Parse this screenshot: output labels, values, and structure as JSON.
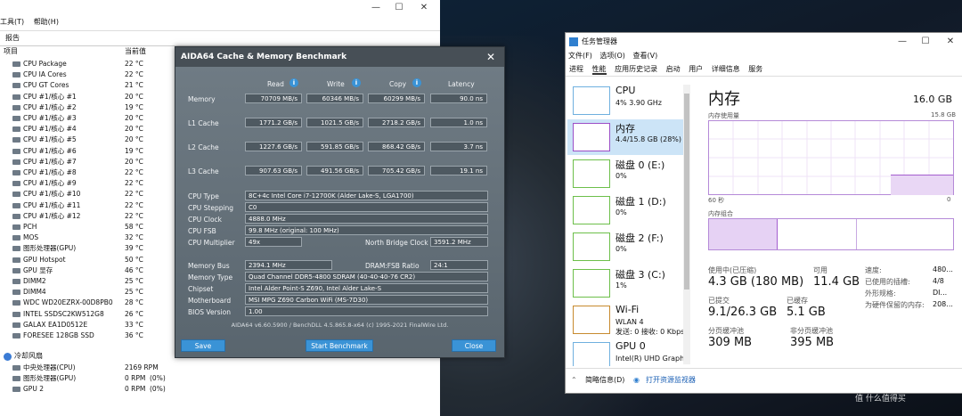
{
  "sensor_window": {
    "menu": [
      "工具(T)",
      "帮助(H)"
    ],
    "report_label": "报告",
    "col_item": "项目",
    "col_value": "当前值",
    "rows": [
      {
        "name": "CPU Package",
        "value": "22 °C"
      },
      {
        "name": "CPU IA Cores",
        "value": "22 °C"
      },
      {
        "name": "CPU GT Cores",
        "value": "21 °C"
      },
      {
        "name": "CPU #1/核心 #1",
        "value": "20 °C"
      },
      {
        "name": "CPU #1/核心 #2",
        "value": "19 °C"
      },
      {
        "name": "CPU #1/核心 #3",
        "value": "20 °C"
      },
      {
        "name": "CPU #1/核心 #4",
        "value": "20 °C"
      },
      {
        "name": "CPU #1/核心 #5",
        "value": "20 °C"
      },
      {
        "name": "CPU #1/核心 #6",
        "value": "19 °C"
      },
      {
        "name": "CPU #1/核心 #7",
        "value": "20 °C"
      },
      {
        "name": "CPU #1/核心 #8",
        "value": "22 °C"
      },
      {
        "name": "CPU #1/核心 #9",
        "value": "22 °C"
      },
      {
        "name": "CPU #1/核心 #10",
        "value": "22 °C"
      },
      {
        "name": "CPU #1/核心 #11",
        "value": "22 °C"
      },
      {
        "name": "CPU #1/核心 #12",
        "value": "22 °C"
      },
      {
        "name": "PCH",
        "value": "58 °C"
      },
      {
        "name": "MOS",
        "value": "32 °C"
      },
      {
        "name": "图形处理器(GPU)",
        "value": "39 °C"
      },
      {
        "name": "GPU Hotspot",
        "value": "50 °C"
      },
      {
        "name": "GPU 显存",
        "value": "46 °C"
      },
      {
        "name": "DIMM2",
        "value": "25 °C"
      },
      {
        "name": "DIMM4",
        "value": "25 °C"
      },
      {
        "name": "WDC WD20EZRX-00D8PB0",
        "value": "28 °C"
      },
      {
        "name": "INTEL SSDSC2KW512G8",
        "value": "26 °C"
      },
      {
        "name": "GALAX EA1D0512E",
        "value": "33 °C"
      },
      {
        "name": "FORESEE 128GB SSD",
        "value": "36 °C"
      }
    ],
    "fan_header": "冷却风扇",
    "fans": [
      {
        "name": "中央处理器(CPU)",
        "value": "2169 RPM",
        "pct": ""
      },
      {
        "name": "图形处理器(GPU)",
        "value": "0 RPM",
        "pct": "(0%)"
      },
      {
        "name": "GPU 2",
        "value": "0 RPM",
        "pct": "(0%)"
      }
    ]
  },
  "aida": {
    "title": "AIDA64 Cache & Memory Benchmark",
    "cols": [
      "Read",
      "Write",
      "Copy",
      "Latency"
    ],
    "bench": [
      {
        "label": "Memory",
        "read": "70709 MB/s",
        "write": "60346 MB/s",
        "copy": "60299 MB/s",
        "latency": "90.0 ns"
      },
      {
        "label": "L1 Cache",
        "read": "1771.2 GB/s",
        "write": "1021.5 GB/s",
        "copy": "2718.2 GB/s",
        "latency": "1.0 ns"
      },
      {
        "label": "L2 Cache",
        "read": "1227.6 GB/s",
        "write": "591.85 GB/s",
        "copy": "868.42 GB/s",
        "latency": "3.7 ns"
      },
      {
        "label": "L3 Cache",
        "read": "907.63 GB/s",
        "write": "491.56 GB/s",
        "copy": "705.42 GB/s",
        "latency": "19.1 ns"
      }
    ],
    "cpu_type_label": "CPU Type",
    "cpu_type": "8C+4c Intel Core i7-12700K  (Alder Lake-S, LGA1700)",
    "cpu_stepping_label": "CPU Stepping",
    "cpu_stepping": "C0",
    "cpu_clock_label": "CPU Clock",
    "cpu_clock": "4888.0 MHz",
    "cpu_fsb_label": "CPU FSB",
    "cpu_fsb": "99.8 MHz  (original: 100 MHz)",
    "cpu_mult_label": "CPU Multiplier",
    "cpu_mult": "49x",
    "nb_clock_label": "North Bridge Clock",
    "nb_clock": "3591.2 MHz",
    "mem_bus_label": "Memory Bus",
    "mem_bus": "2394.1 MHz",
    "dram_fsb_label": "DRAM:FSB Ratio",
    "dram_fsb": "24:1",
    "mem_type_label": "Memory Type",
    "mem_type": "Quad Channel DDR5-4800 SDRAM  (40-40-40-76 CR2)",
    "chipset_label": "Chipset",
    "chipset": "Intel Alder Point-S Z690, Intel Alder Lake-S",
    "mobo_label": "Motherboard",
    "mobo": "MSI MPG Z690 Carbon WiFi (MS-7D30)",
    "bios_label": "BIOS Version",
    "bios": "1.00",
    "footer": "AIDA64 v6.60.5900 / BenchDLL 4.5.865.8-x64  (c) 1995-2021 FinalWire Ltd.",
    "save": "Save",
    "start": "Start Benchmark",
    "close": "Close"
  },
  "taskmgr": {
    "title": "任务管理器",
    "menu": [
      "文件(F)",
      "选项(O)",
      "查看(V)"
    ],
    "tabs": [
      "进程",
      "性能",
      "应用历史记录",
      "启动",
      "用户",
      "详细信息",
      "服务"
    ],
    "side": [
      {
        "name": "CPU",
        "sub": "4%  3.90 GHz",
        "sub2": ""
      },
      {
        "name": "内存",
        "sub": "4.4/15.8 GB (28%)",
        "sub2": ""
      },
      {
        "name": "磁盘 0 (E:)",
        "sub": "0%",
        "sub2": ""
      },
      {
        "name": "磁盘 1 (D:)",
        "sub": "0%",
        "sub2": ""
      },
      {
        "name": "磁盘 2 (F:)",
        "sub": "0%",
        "sub2": ""
      },
      {
        "name": "磁盘 3 (C:)",
        "sub": "1%",
        "sub2": ""
      },
      {
        "name": "Wi-Fi",
        "sub": "WLAN 4",
        "sub2": "发送: 0 接收: 0 Kbps"
      },
      {
        "name": "GPU 0",
        "sub": "Intel(R) UHD Graph",
        "sub2": ""
      }
    ],
    "mem_title": "内存",
    "mem_total": "16.0 GB",
    "usage_label": "内存使用量",
    "usage_max": "15.8 GB",
    "time_left": "60 秒",
    "time_right": "0",
    "compose_label": "内存组合",
    "in_use_label": "使用中(已压缩)",
    "in_use": "4.3 GB (180 MB)",
    "avail_label": "可用",
    "avail": "11.4 GB",
    "commit_label": "已提交",
    "commit": "9.1/26.3 GB",
    "cached_label": "已缓存",
    "cached": "5.1 GB",
    "paged_label": "分页缓冲池",
    "paged": "309 MB",
    "nonpaged_label": "非分页缓冲池",
    "nonpaged": "395 MB",
    "speed_label": "速度:",
    "speed": "480...",
    "slots_label": "已使用的插槽:",
    "slots": "4/8",
    "form_label": "外形规格:",
    "form": "DI...",
    "reserved_label": "为硬件保留的内存:",
    "reserved": "208...",
    "brief": "简略信息(D)",
    "resmon": "打开资源监视器"
  },
  "watermark": "值 什么值得买"
}
